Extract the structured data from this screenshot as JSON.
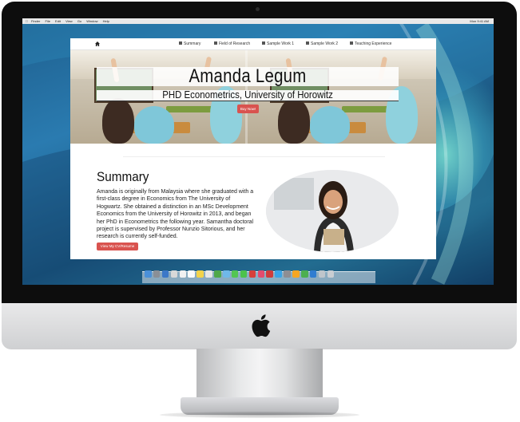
{
  "menubar": {
    "apple_icon": "apple-icon",
    "items": [
      "Finder",
      "File",
      "Edit",
      "View",
      "Go",
      "Window",
      "Help"
    ],
    "status": "Mon 9:41 AM"
  },
  "site": {
    "nav": {
      "home_icon": "home-icon",
      "links": [
        {
          "label": "Summary",
          "icon": "list-icon"
        },
        {
          "label": "Field of Research",
          "icon": "book-icon"
        },
        {
          "label": "Sample Work 1",
          "icon": "document-icon"
        },
        {
          "label": "Sample Work 2",
          "icon": "document-icon"
        },
        {
          "label": "Teaching Experience",
          "icon": "pencil-icon"
        }
      ]
    },
    "hero": {
      "name": "Amanda Legum",
      "subtitle": "PHD Econometrics, University of Horowitz",
      "buy_button": "Buy Now!"
    },
    "summary": {
      "title": "Summary",
      "text": "Amanda is originally from Malaysia where she graduated with a first-class degree in Economics from The University of Hogwartz. She obtained a distinction in an MSc Development Economics from the University of Horowitz in 2013, and began her PhD in Econometrics the following year. Samantha doctoral project is supervised by Professor Nunzio Sitorious, and her research is currently self-funded.",
      "cv_button": "View My CV/Resume"
    }
  },
  "colors": {
    "accent": "#d9534f",
    "desktop": "#1f6a9a"
  }
}
